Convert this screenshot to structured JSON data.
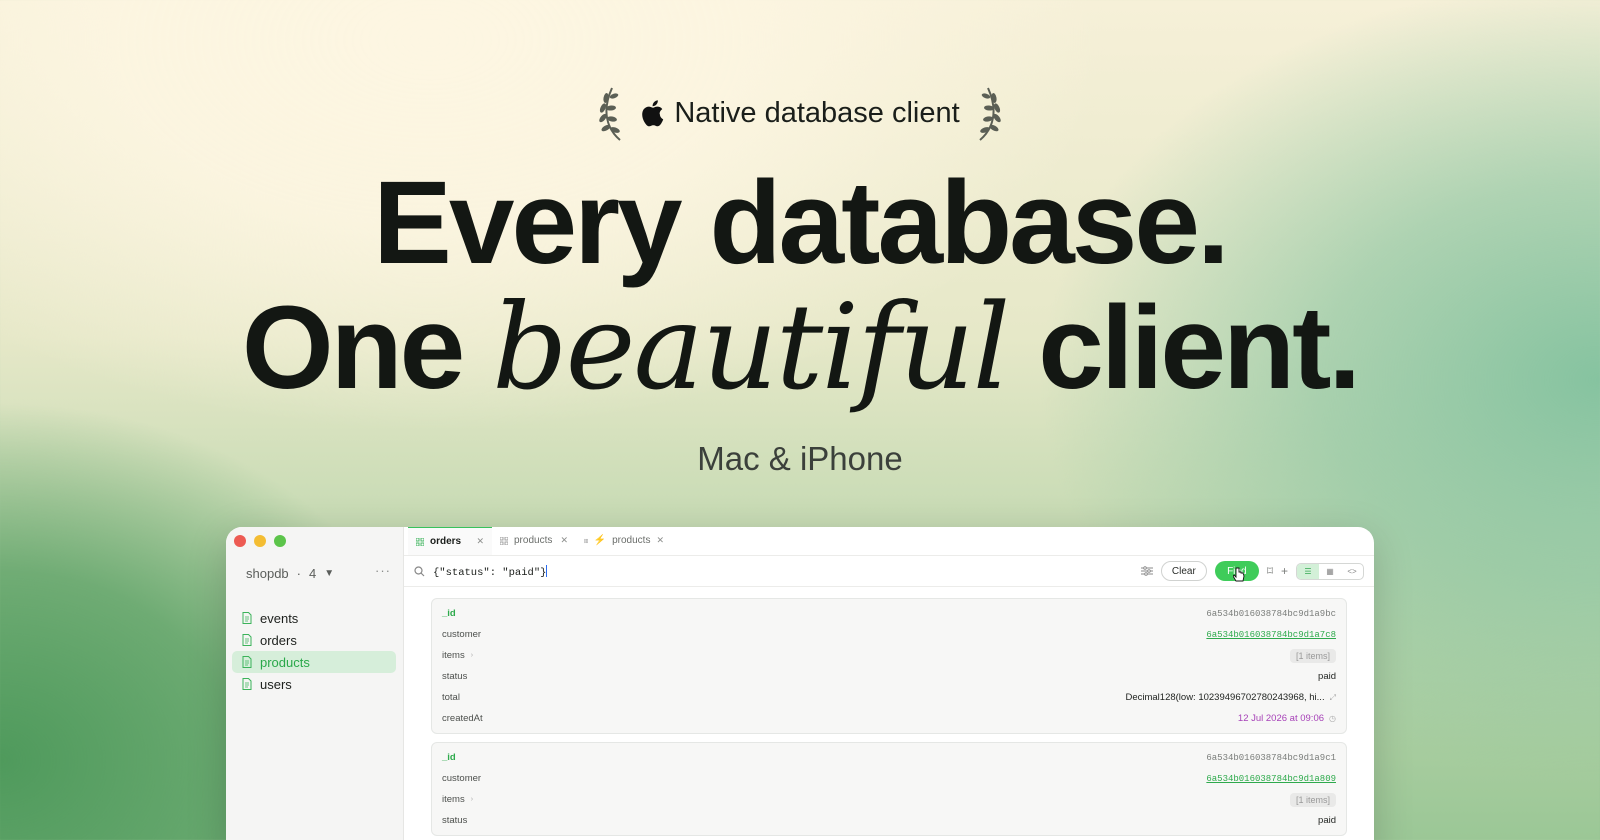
{
  "hero": {
    "badge": "Native database client",
    "line1": "Every database.",
    "line2_pre": "One",
    "line2_italic": "beautiful",
    "line2_post": "client.",
    "subtitle": "Mac & iPhone"
  },
  "sidebar": {
    "db": "shopdb",
    "db_count": "4",
    "more": "···",
    "collections": [
      {
        "label": "events"
      },
      {
        "label": "orders"
      },
      {
        "label": "products"
      },
      {
        "label": "users"
      }
    ]
  },
  "tabs": [
    {
      "label": "orders"
    },
    {
      "label": "products"
    },
    {
      "label": "products"
    }
  ],
  "query": {
    "text": "{\"status\": \"paid\"}",
    "clear": "Clear",
    "find": "Find"
  },
  "docs": [
    {
      "id_key": "_id",
      "id": "6a534b016038784bc9d1a9bc",
      "customer_key": "customer",
      "customer": "6a534b016038784bc9d1a7c8",
      "items_key": "items",
      "items": "[1 items]",
      "status_key": "status",
      "status": "paid",
      "total_key": "total",
      "total": "Decimal128(low: 10239496702780243968, hi...",
      "created_key": "createdAt",
      "created": "12 Jul 2026 at 09:06"
    },
    {
      "id_key": "_id",
      "id": "6a534b016038784bc9d1a9c1",
      "customer_key": "customer",
      "customer": "6a534b016038784bc9d1a809",
      "items_key": "items",
      "items": "[1 items]",
      "status_key": "status",
      "status": "paid"
    }
  ],
  "colors": {
    "accent": "#3fcc5a",
    "date": "#a742b8"
  }
}
